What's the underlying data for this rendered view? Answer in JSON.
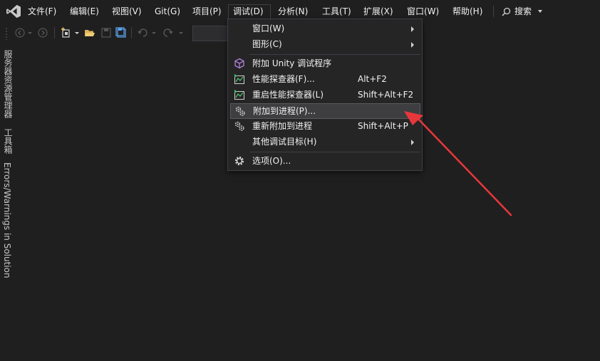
{
  "menubar": {
    "items": [
      {
        "label": "文件(F)"
      },
      {
        "label": "编辑(E)"
      },
      {
        "label": "视图(V)"
      },
      {
        "label": "Git(G)"
      },
      {
        "label": "项目(P)"
      },
      {
        "label": "调试(D)"
      },
      {
        "label": "分析(N)"
      },
      {
        "label": "工具(T)"
      },
      {
        "label": "扩展(X)"
      },
      {
        "label": "窗口(W)"
      },
      {
        "label": "帮助(H)"
      }
    ],
    "search_label": "搜索"
  },
  "side_tabs": [
    {
      "label": "服务器资源管理器"
    },
    {
      "label": "工具箱"
    },
    {
      "label": "Errors/Warnings in Solution"
    }
  ],
  "debug_menu": {
    "items": [
      {
        "label": "窗口(W)",
        "shortcut": "",
        "icon": "none",
        "submenu": true
      },
      {
        "label": "图形(C)",
        "shortcut": "",
        "icon": "none",
        "submenu": true
      },
      {
        "label": "附加 Unity 调试程序",
        "shortcut": "",
        "icon": "unity-cube-icon",
        "submenu": false
      },
      {
        "label": "性能探查器(F)...",
        "shortcut": "Alt+F2",
        "icon": "performance-profiler-icon",
        "submenu": false
      },
      {
        "label": "重启性能探查器(L)",
        "shortcut": "Shift+Alt+F2",
        "icon": "performance-profiler-icon",
        "submenu": false
      },
      {
        "label": "附加到进程(P)...",
        "shortcut": "",
        "icon": "attach-gear-icon",
        "submenu": false,
        "highlighted": true
      },
      {
        "label": "重新附加到进程",
        "shortcut": "Shift+Alt+P",
        "icon": "attach-gear-icon",
        "submenu": false
      },
      {
        "label": "其他调试目标(H)",
        "shortcut": "",
        "icon": "none",
        "submenu": true
      },
      {
        "label": "选项(O)...",
        "shortcut": "",
        "icon": "settings-gear-icon",
        "submenu": false
      }
    ]
  },
  "colors": {
    "background": "#1f1f1f",
    "menu_background": "#252526",
    "highlight": "#3e3e40",
    "annotation_arrow": "#e8373b",
    "logo_purple": "#b180d7"
  }
}
